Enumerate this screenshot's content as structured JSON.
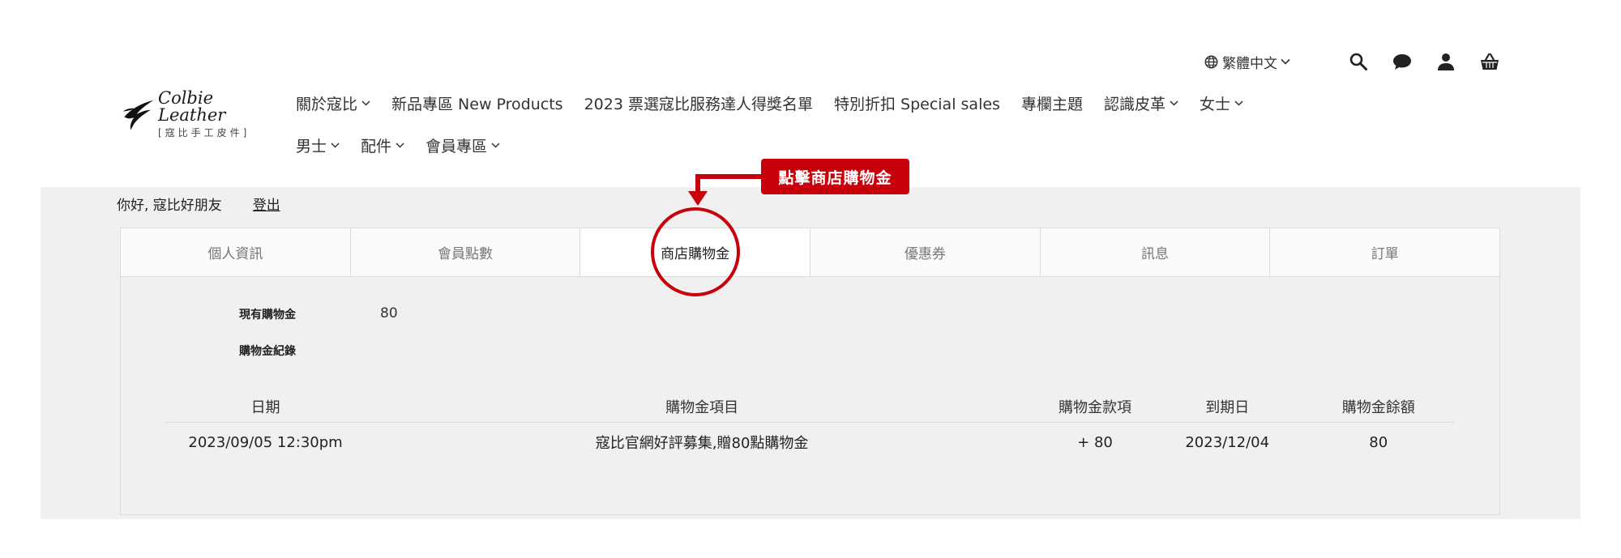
{
  "brand": {
    "logo_main": "Colbie Leather",
    "logo_sub": "[寇比手工皮件]"
  },
  "topbar": {
    "language": "繁體中文",
    "icons": [
      "globe-icon",
      "search-icon",
      "chat-icon",
      "account-icon",
      "cart-icon"
    ]
  },
  "nav": {
    "row1": [
      {
        "label": "關於寇比",
        "dropdown": true
      },
      {
        "label": "新品專區 New Products",
        "dropdown": false
      },
      {
        "label": "2023 票選寇比服務達人得獎名單",
        "dropdown": false
      },
      {
        "label": "特別折扣 Special sales",
        "dropdown": false
      },
      {
        "label": "專欄主題",
        "dropdown": false
      },
      {
        "label": "認識皮革",
        "dropdown": true
      },
      {
        "label": "女士",
        "dropdown": true
      }
    ],
    "row2": [
      {
        "label": "男士",
        "dropdown": true
      },
      {
        "label": "配件",
        "dropdown": true
      },
      {
        "label": "會員專區",
        "dropdown": true
      }
    ]
  },
  "account": {
    "greeting": "你好, 寇比好朋友",
    "logout": "登出"
  },
  "tabs": [
    "個人資訊",
    "會員點數",
    "商店購物金",
    "優惠券",
    "訊息",
    "訂單"
  ],
  "credit": {
    "current_label": "現有購物金",
    "current_value": "80",
    "history_label": "購物金紀錄"
  },
  "table": {
    "headers": [
      "日期",
      "購物金項目",
      "購物金款項",
      "到期日",
      "購物金餘額"
    ],
    "rows": [
      [
        "2023/09/05 12:30pm",
        "寇比官網好評募集,贈80點購物金",
        "+ 80",
        "2023/12/04",
        "80"
      ]
    ]
  },
  "annotation": {
    "callout": "點擊商店購物金",
    "color": "#c8000c"
  }
}
